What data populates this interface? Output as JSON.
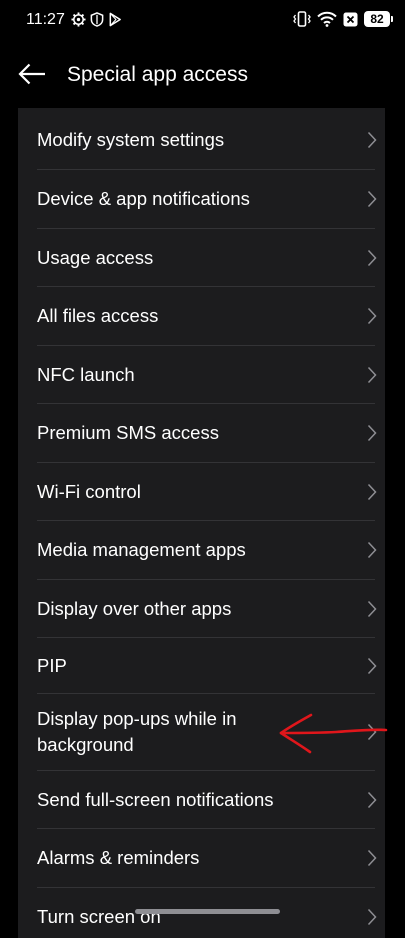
{
  "status_bar": {
    "time": "11:27",
    "battery": "82",
    "left_icons": [
      "gear-icon",
      "shield-icon",
      "play-store-icon"
    ],
    "right_icons": [
      "vibrate-icon",
      "wifi-icon",
      "close-box-icon",
      "battery-icon"
    ]
  },
  "header": {
    "title": "Special app access",
    "back_icon": "arrow-left-icon"
  },
  "list": {
    "items": [
      {
        "label": "Modify system settings"
      },
      {
        "label": "Device & app notifications"
      },
      {
        "label": "Usage access"
      },
      {
        "label": "All files access"
      },
      {
        "label": "NFC launch"
      },
      {
        "label": "Premium SMS access"
      },
      {
        "label": "Wi-Fi control"
      },
      {
        "label": "Media management apps"
      },
      {
        "label": "Display over other apps"
      },
      {
        "label": "PIP"
      },
      {
        "label": "Display pop-ups while in background"
      },
      {
        "label": "Send full-screen notifications"
      },
      {
        "label": "Alarms & reminders"
      },
      {
        "label": "Turn screen on"
      }
    ],
    "chevron_icon": "chevron-right-icon"
  },
  "colors": {
    "background": "#000000",
    "card": "#1c1c1e",
    "text": "#ffffff",
    "chevron": "#8e8e93",
    "annotation": "#e0161b"
  }
}
